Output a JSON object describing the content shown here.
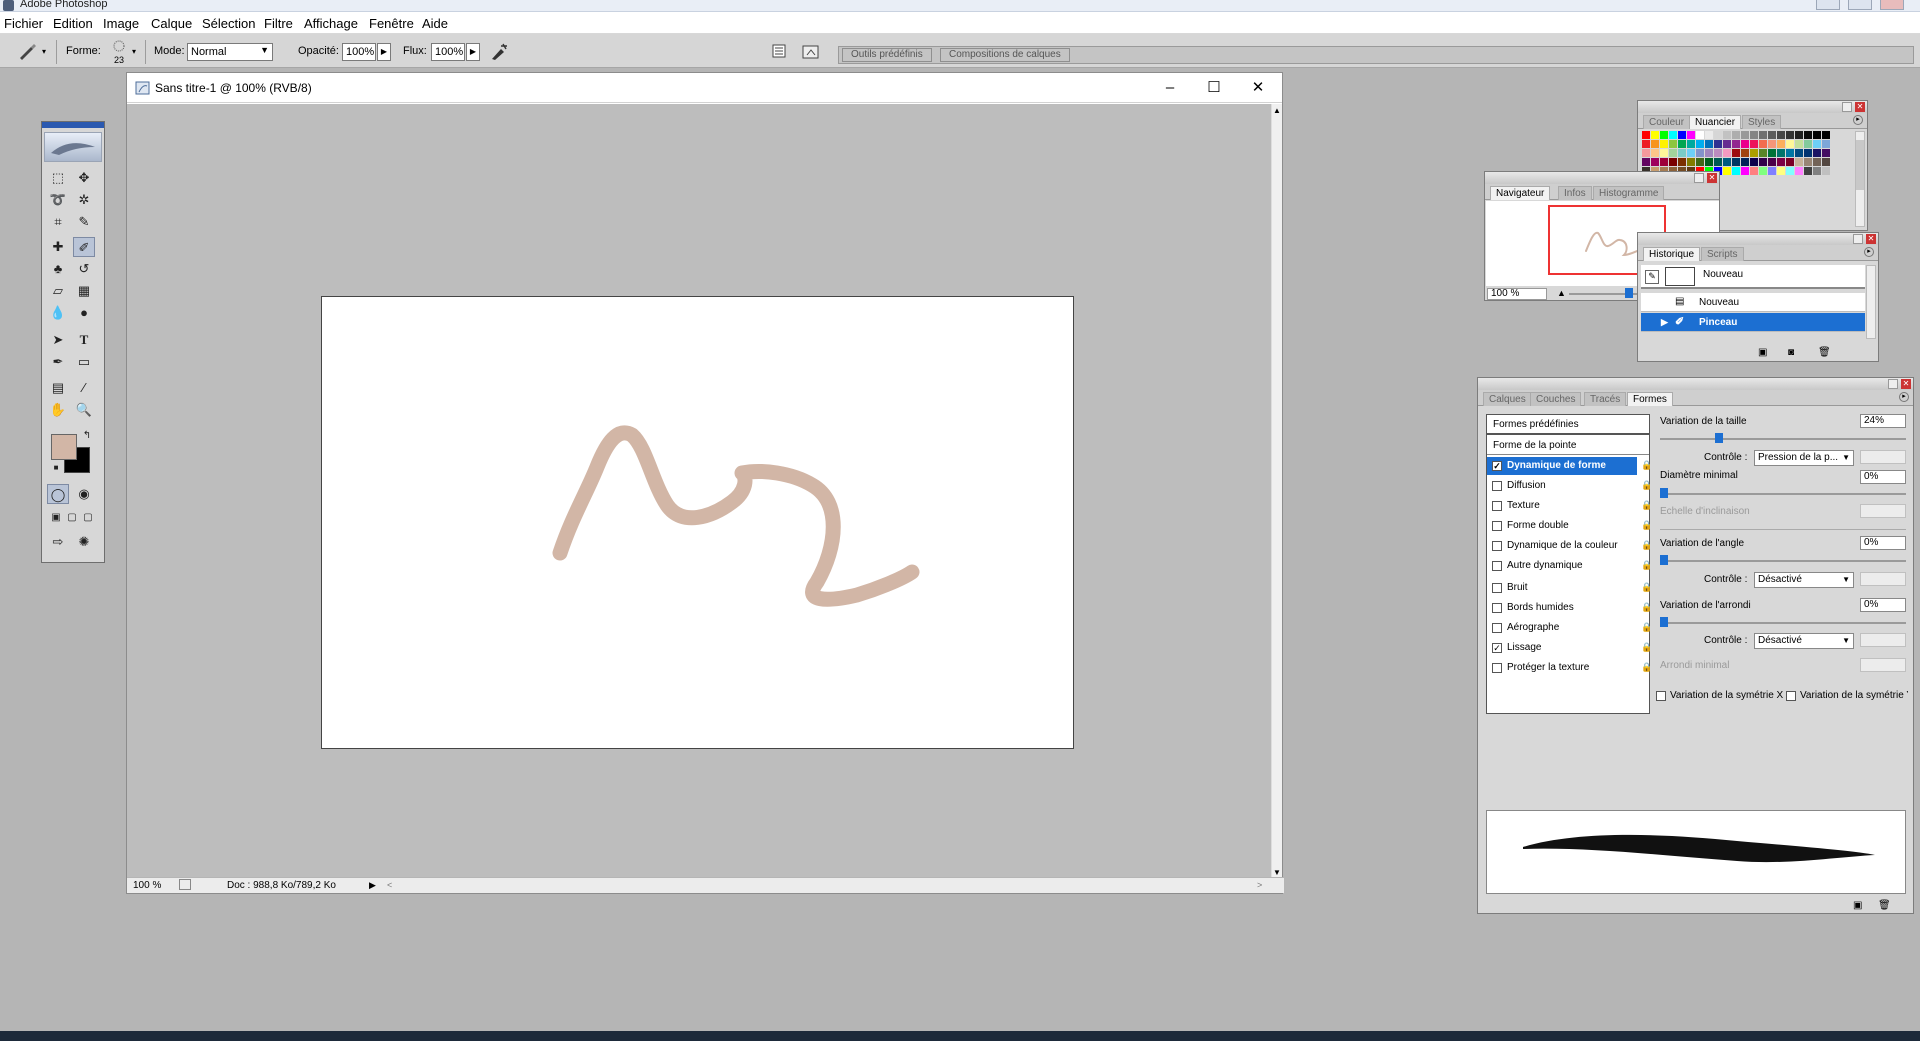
{
  "app": {
    "title": "Adobe Photoshop"
  },
  "menu": [
    "Fichier",
    "Edition",
    "Image",
    "Calque",
    "Sélection",
    "Filtre",
    "Affichage",
    "Fenêtre",
    "Aide"
  ],
  "options": {
    "forme_label": "Forme:",
    "forme_size": "23",
    "mode_label": "Mode:",
    "mode_value": "Normal",
    "opacite_label": "Opacité:",
    "opacite_value": "100%",
    "flux_label": "Flux:",
    "flux_value": "100%",
    "well_tabs": [
      "Outils prédéfinis",
      "Compositions de calques"
    ]
  },
  "document": {
    "title": "Sans titre-1 @ 100% (RVB/8)",
    "zoom": "100 %",
    "doc_info": "Doc : 988,8 Ko/789,2 Ko",
    "stroke_color": "#d2b6a6"
  },
  "colors": {
    "foreground": "#d2b6a6",
    "background": "#000000",
    "accent": "#1c6fd2"
  },
  "palette_colors": {
    "tabs": [
      "Couleur",
      "Nuancier",
      "Styles"
    ],
    "active": "Nuancier"
  },
  "navigator": {
    "tabs": [
      "Navigateur",
      "Infos",
      "Histogramme"
    ],
    "active": "Navigateur",
    "zoom": "100 %"
  },
  "history": {
    "tabs": [
      "Historique",
      "Scripts"
    ],
    "active": "Historique",
    "snapshot": "Nouveau",
    "states": [
      {
        "label": "Nouveau",
        "selected": false
      },
      {
        "label": "Pinceau",
        "selected": true
      }
    ]
  },
  "brushes": {
    "tabs": [
      "Calques",
      "Couches",
      "Tracés",
      "Formes"
    ],
    "active": "Formes",
    "header": "Formes prédéfinies",
    "tip_shape": "Forme de la pointe",
    "items": [
      {
        "label": "Dynamique de forme",
        "checked": true,
        "selected": true
      },
      {
        "label": "Diffusion",
        "checked": false
      },
      {
        "label": "Texture",
        "checked": false
      },
      {
        "label": "Forme double",
        "checked": false
      },
      {
        "label": "Dynamique de la couleur",
        "checked": false
      },
      {
        "label": "Autre dynamique",
        "checked": false
      },
      {
        "label": "Bruit",
        "checked": false
      },
      {
        "label": "Bords humides",
        "checked": false
      },
      {
        "label": "Aérographe",
        "checked": false
      },
      {
        "label": "Lissage",
        "checked": true
      },
      {
        "label": "Protéger la texture",
        "checked": false
      }
    ],
    "size_jitter_label": "Variation de la taille",
    "size_jitter_value": "24%",
    "controle_label": "Contrôle :",
    "control_1": "Pression de la p...",
    "min_diameter_label": "Diamètre minimal",
    "min_diameter_value": "0%",
    "tilt_scale_label": "Echelle d'inclinaison",
    "angle_jitter_label": "Variation de l'angle",
    "angle_jitter_value": "0%",
    "control_2": "Désactivé",
    "roundness_jitter_label": "Variation de l'arrondi",
    "roundness_jitter_value": "0%",
    "control_3": "Désactivé",
    "min_roundness_label": "Arrondi minimal",
    "flip_x_label": "Variation de la symétrie X",
    "flip_y_label": "Variation de la symétrie Y",
    "size_jitter_fraction": 0.24
  }
}
